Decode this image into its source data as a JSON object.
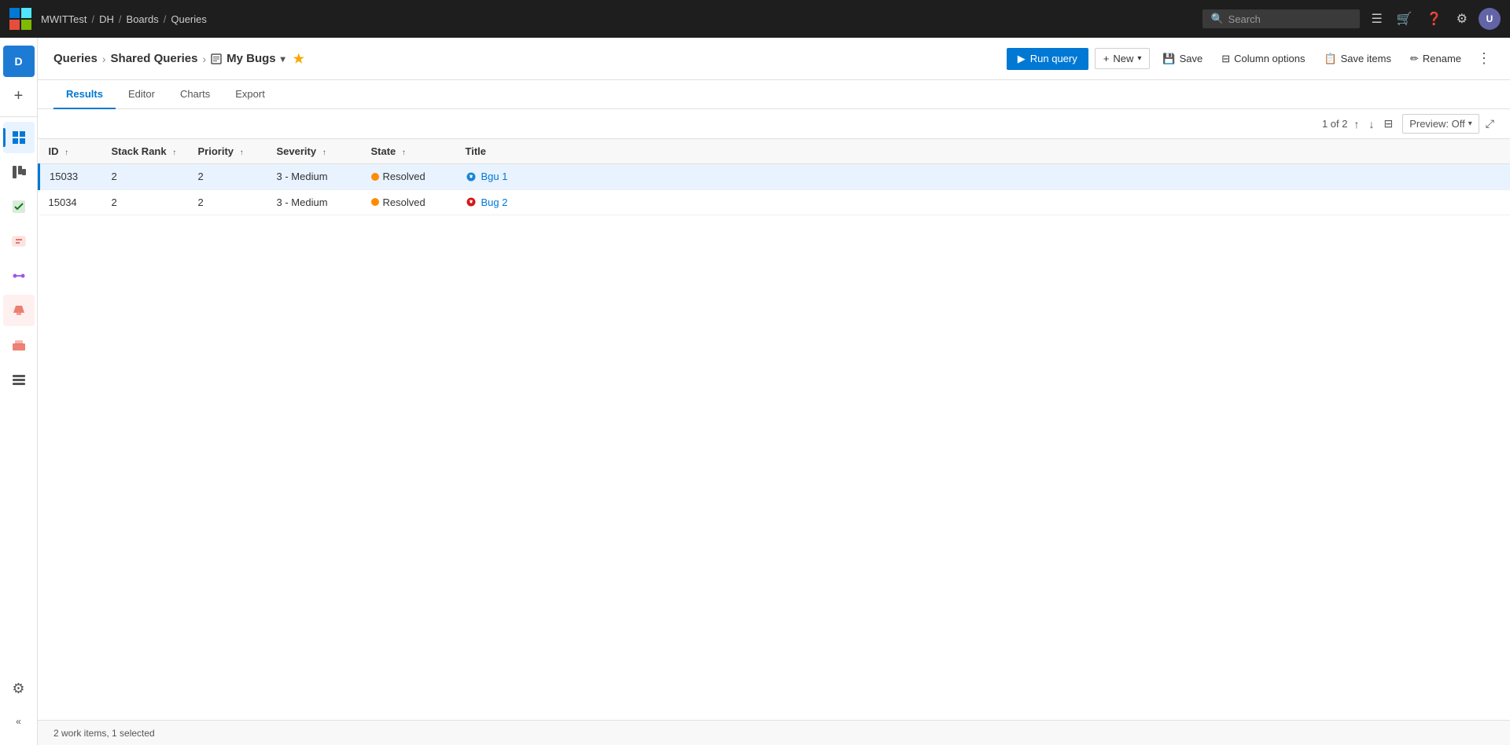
{
  "topbar": {
    "project": "MWITTest",
    "section1": "DH",
    "section2": "Boards",
    "section3": "Queries",
    "search_placeholder": "Search"
  },
  "breadcrumb": {
    "queries": "Queries",
    "shared_queries": "Shared Queries",
    "my_bugs": "My Bugs"
  },
  "actions": {
    "run_query": "Run query",
    "new": "New",
    "save": "Save",
    "column_options": "Column options",
    "save_items": "Save items",
    "rename": "Rename"
  },
  "tabs": {
    "results": "Results",
    "editor": "Editor",
    "charts": "Charts",
    "export": "Export"
  },
  "toolbar": {
    "pagination": "1 of 2",
    "preview": "Preview: Off"
  },
  "columns": {
    "id": "ID",
    "stack_rank": "Stack Rank",
    "priority": "Priority",
    "severity": "Severity",
    "state": "State",
    "title": "Title"
  },
  "rows": [
    {
      "id": "15033",
      "stack_rank": "2",
      "priority": "2",
      "severity": "3 - Medium",
      "state": "Resolved",
      "title": "Bgu 1",
      "selected": true
    },
    {
      "id": "15034",
      "stack_rank": "2",
      "priority": "2",
      "severity": "3 - Medium",
      "state": "Resolved",
      "title": "Bug 2",
      "selected": false
    }
  ],
  "status_bar": {
    "items_count": "2 work items,",
    "selected": "1 selected"
  },
  "sidebar": {
    "items": [
      {
        "icon": "🏠",
        "name": "home",
        "active": false
      },
      {
        "icon": "📋",
        "name": "boards",
        "active": false
      },
      {
        "icon": "✓",
        "name": "work-items",
        "active": true
      },
      {
        "icon": "📌",
        "name": "queries",
        "active": false
      },
      {
        "icon": "🔀",
        "name": "repos",
        "active": false
      },
      {
        "icon": "🧪",
        "name": "test",
        "active": false
      },
      {
        "icon": "📦",
        "name": "artifacts",
        "active": false
      },
      {
        "icon": "🔷",
        "name": "pipelines",
        "active": false
      }
    ]
  }
}
